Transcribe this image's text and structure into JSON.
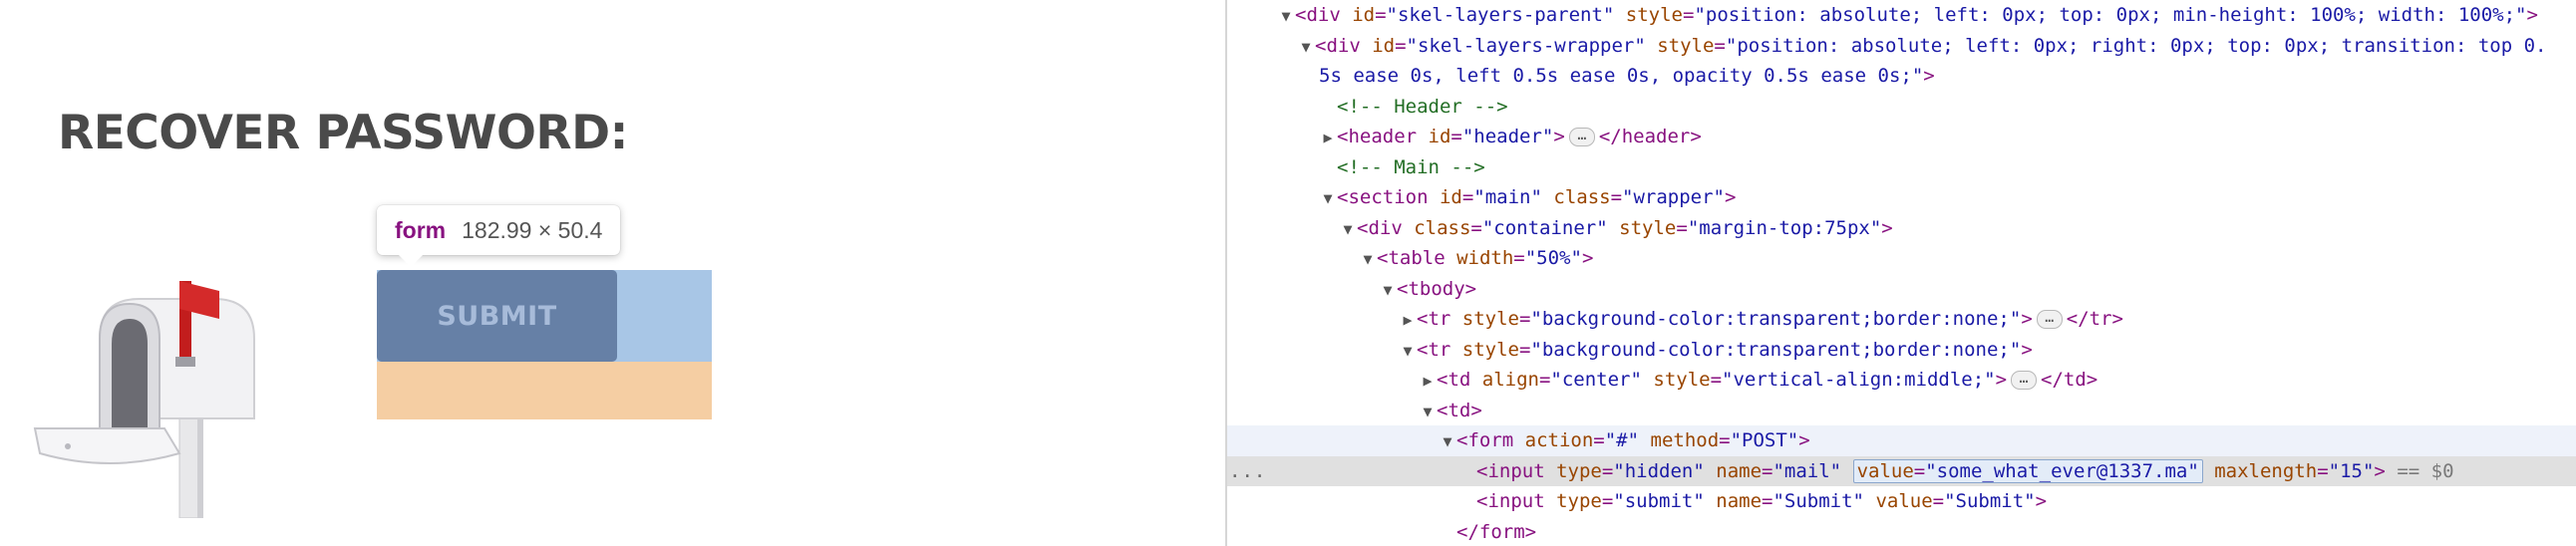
{
  "page": {
    "title": "RECOVER PASSWORD:",
    "tooltip": {
      "tag": "form",
      "dimensions": "182.99 × 50.4"
    },
    "submit_label": "SUBMIT",
    "colors": {
      "submit_bg": "#6680a6",
      "padding_overlay": "#a8c6e6",
      "margin_overlay": "#f5ceA3"
    }
  },
  "devtools": {
    "lines": [
      {
        "id": "l1",
        "text": "<div id=\"skel-layers-parent\" style=\"position: absolute; left: 0px; top: 0px; min-height: 100%; width: 100%;\">"
      },
      {
        "id": "l2a",
        "text": "<div id=\"skel-layers-wrapper\" style=\"position: absolute; left: 0px; right: 0px; top: 0px; transition: top 0."
      },
      {
        "id": "l2b",
        "text": "5s ease 0s, left 0.5s ease 0s, opacity 0.5s ease 0s;\">"
      },
      {
        "id": "l3",
        "text": "<!-- Header -->"
      },
      {
        "id": "l4",
        "text": "<header id=\"header\">…</header>"
      },
      {
        "id": "l5",
        "text": "<!-- Main -->"
      },
      {
        "id": "l6",
        "text": "<section id=\"main\" class=\"wrapper\">"
      },
      {
        "id": "l7",
        "text": "<div class=\"container\" style=\"margin-top:75px\">"
      },
      {
        "id": "l8",
        "text": "<table width=\"50%\">"
      },
      {
        "id": "l9",
        "text": "<tbody>"
      },
      {
        "id": "l10",
        "text": "<tr style=\"background-color:transparent;border:none;\">…</tr>"
      },
      {
        "id": "l11",
        "text": "<tr style=\"background-color:transparent;border:none;\">"
      },
      {
        "id": "l12",
        "text": "<td align=\"center\" style=\"vertical-align:middle;\">…</td>"
      },
      {
        "id": "l13",
        "text": "<td>"
      },
      {
        "id": "l14",
        "text": "<form action=\"#\" method=\"POST\">"
      },
      {
        "id": "l15",
        "text": "<input type=\"hidden\" name=\"mail\" value=\"some_what_ever@1337.ma\" maxlength=\"15\"> == $0"
      },
      {
        "id": "l16",
        "text": "<input type=\"submit\" name=\"Submit\" value=\"Submit\">"
      },
      {
        "id": "l17",
        "text": "</form>"
      }
    ],
    "selected_suffix": "== $0",
    "gutter_menu": "..."
  }
}
